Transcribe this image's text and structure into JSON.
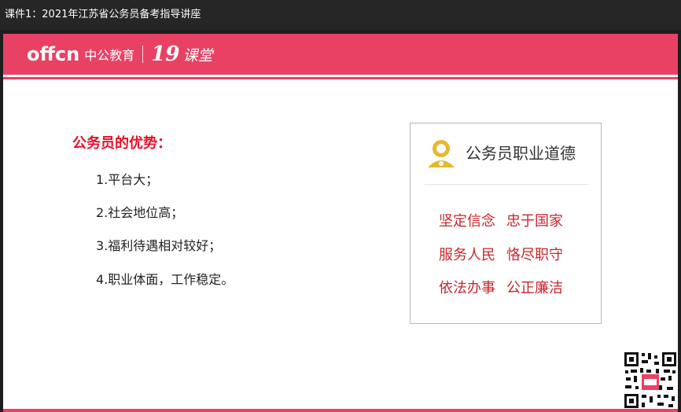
{
  "window": {
    "title": "课件1：2021年江苏省公务员备考指导讲座"
  },
  "banner": {
    "logo_offcn": "offcn",
    "logo_brand": "中公教育",
    "logo_19": "19",
    "logo_ketang": "课堂"
  },
  "advantages": {
    "heading": "公务员的优势：",
    "items": [
      "1.平台大；",
      "2.社会地位高；",
      "3.福利待遇相对较好；",
      "4.职业体面，工作稳定。"
    ]
  },
  "ethics_card": {
    "icon": "user-icon",
    "title": "公务员职业道德",
    "lines": [
      [
        "坚定信念",
        "忠于国家"
      ],
      [
        "服务人民",
        "恪尽职守"
      ],
      [
        "依法办事",
        "公正廉洁"
      ]
    ]
  },
  "qr": {
    "icon": "qr-code-icon"
  },
  "colors": {
    "accent": "#e94164",
    "heading_red": "#e8102a",
    "card_red": "#c9262b",
    "icon_gold": "#e4b92c"
  }
}
